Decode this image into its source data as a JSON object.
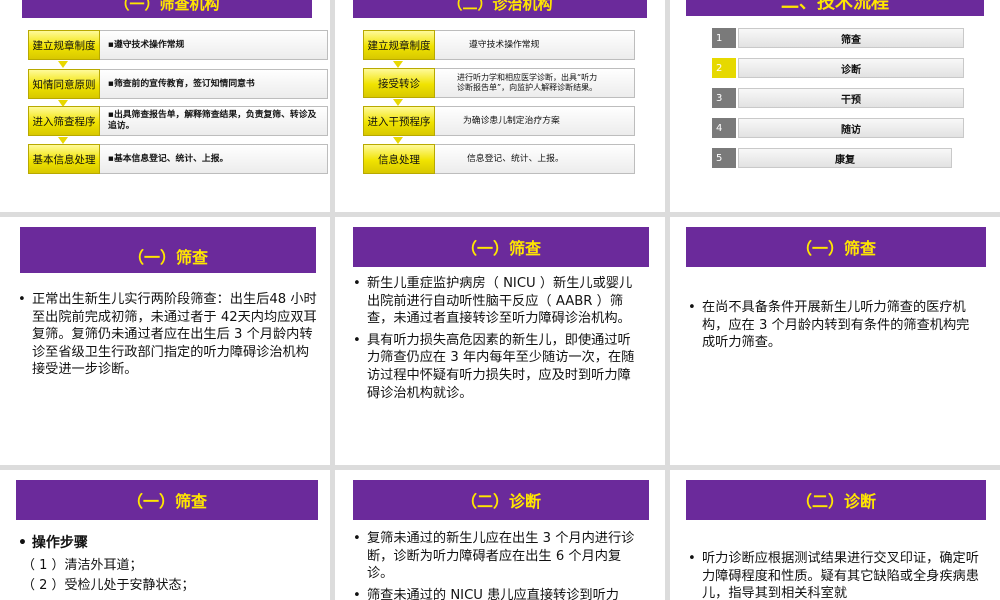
{
  "slide1": {
    "title": "（一）筛查机构",
    "rows": [
      {
        "tag": "建立规章制度",
        "desc": "▪遵守技术操作常规"
      },
      {
        "tag": "知情同意原则",
        "desc": "▪筛查前的宣传教育，签订知情同意书"
      },
      {
        "tag": "进入筛查程序",
        "desc": "▪出具筛查报告单，解释筛查结果，负责复筛、转诊及追访。"
      },
      {
        "tag": "基本信息处理",
        "desc": "▪基本信息登记、统计、上报。"
      }
    ]
  },
  "slide2": {
    "title": "（二）诊治机构",
    "rows": [
      {
        "tag": "建立规章制度",
        "desc": "遵守技术操作常规"
      },
      {
        "tag": "接受转诊",
        "desc": "进行听力学和相应医学诊断，出具“听力诊断报告单”，向监护人解释诊断结果。"
      },
      {
        "tag": "进入干预程序",
        "desc": "为确诊患儿制定治疗方案"
      },
      {
        "tag": "信息处理",
        "desc": "信息登记、统计、上报。"
      }
    ]
  },
  "slide3": {
    "title": "二、技术流程",
    "steps": [
      {
        "num": "1",
        "label": "筛查"
      },
      {
        "num": "2",
        "label": "诊断"
      },
      {
        "num": "3",
        "label": "干预"
      },
      {
        "num": "4",
        "label": "随访"
      },
      {
        "num": "5",
        "label": "康复"
      }
    ]
  },
  "slide4": {
    "title": "（一）筛查",
    "bullets": [
      "正常出生新生儿实行两阶段筛查：出生后48 小时至出院前完成初筛，未通过者于 42天内均应双耳复筛。复筛仍未通过者应在出生后 3 个月龄内转诊至省级卫生行政部门指定的听力障碍诊治机构接受进一步诊断。"
    ]
  },
  "slide5": {
    "title": "（一）筛查",
    "bullets": [
      "新生儿重症监护病房（ NICU ）新生儿或婴儿出院前进行自动听性脑干反应（ AABR ）筛查，未通过者直接转诊至听力障碍诊治机构。",
      "具有听力损失高危因素的新生儿，即使通过听力筛查仍应在 3 年内每年至少随访一次，在随访过程中怀疑有听力损失时，应及时到听力障碍诊治机构就诊。"
    ]
  },
  "slide6": {
    "title": "（一）筛查",
    "bullets": [
      "在尚不具备条件开展新生儿听力筛查的医疗机构，应在 3 个月龄内转到有条件的筛查机构完成听力筛查。"
    ]
  },
  "slide7": {
    "title": "（一）筛查",
    "heading": "操作步骤",
    "steps": [
      "（ 1 ）清洁外耳道；",
      "（ 2 ）受检儿处于安静状态；"
    ]
  },
  "slide8": {
    "title": "（二）诊断",
    "bullets": [
      "复筛未通过的新生儿应在出生 3 个月内进行诊断，诊断为听力障碍者应在出生 6 个月内复诊。",
      "筛查未通过的 NICU 患儿应直接转诊到听力"
    ]
  },
  "slide9": {
    "title": "（二）诊断",
    "bullets": [
      "听力诊断应根据测试结果进行交叉印证，确定听力障碍程度和性质。疑有其它缺陷或全身疾病患儿，指导其到相关科室就"
    ]
  }
}
